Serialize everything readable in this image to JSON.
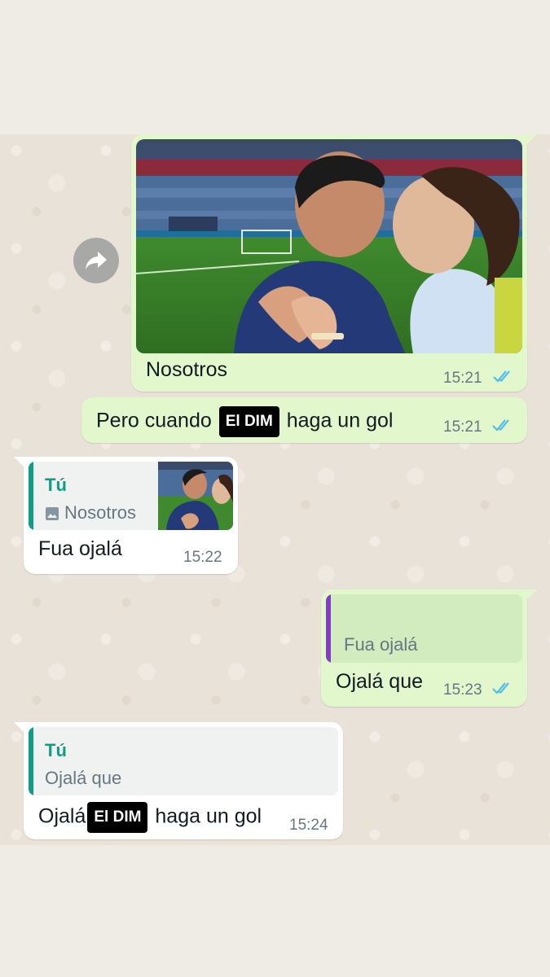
{
  "colors": {
    "outgoing_bubble": "#e2f7cb",
    "incoming_bubble": "#ffffff",
    "tick_blue": "#53bdeb",
    "quote_author": "#0e9e86",
    "quote_bar_self": "#0e9e86",
    "quote_bar_other": "#7f3fbf"
  },
  "icons": {
    "forward": "forward-arrow-icon",
    "double_check": "double-check-icon",
    "photo": "image-icon"
  },
  "messages": [
    {
      "direction": "outgoing",
      "type": "photo",
      "caption": "Nosotros",
      "time": "15:21",
      "status": "read"
    },
    {
      "direction": "outgoing",
      "type": "text",
      "text_before": "Pero cuando",
      "redacted": "El DIM",
      "text_after": "haga un gol",
      "time": "15:21",
      "status": "read"
    },
    {
      "direction": "incoming",
      "type": "reply",
      "quote_author": "Tú",
      "quote_text": "Nosotros",
      "text": "Fua ojalá",
      "time": "15:22"
    },
    {
      "direction": "outgoing",
      "type": "reply",
      "quote_text": "Fua ojalá",
      "text": "Ojalá que",
      "time": "15:23",
      "status": "read"
    },
    {
      "direction": "incoming",
      "type": "reply",
      "quote_author": "Tú",
      "quote_text": "Ojalá que",
      "text_before": "Ojalá",
      "redacted": "El DIM",
      "text_after": "haga un gol",
      "time": "15:24"
    }
  ]
}
